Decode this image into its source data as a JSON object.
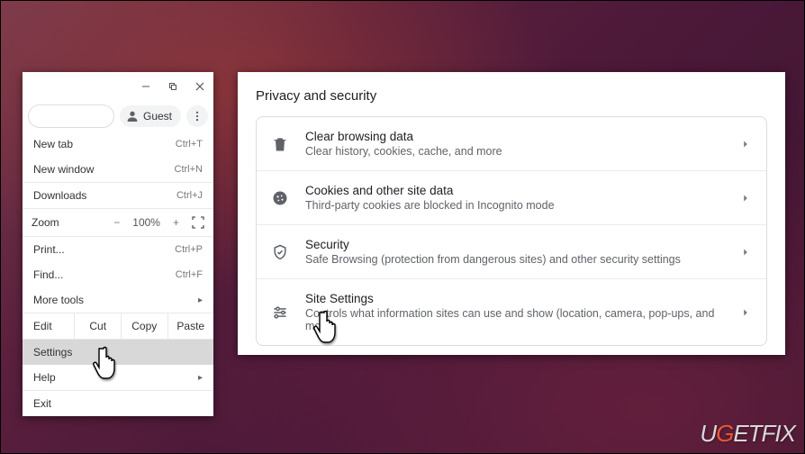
{
  "chrome_window": {
    "guest_label": "Guest",
    "menu": {
      "new_tab": "New tab",
      "new_tab_sc": "Ctrl+T",
      "new_window": "New window",
      "new_window_sc": "Ctrl+N",
      "downloads": "Downloads",
      "downloads_sc": "Ctrl+J",
      "zoom_label": "Zoom",
      "zoom_value": "100%",
      "print": "Print...",
      "print_sc": "Ctrl+P",
      "find": "Find...",
      "find_sc": "Ctrl+F",
      "more_tools": "More tools",
      "edit_label": "Edit",
      "cut": "Cut",
      "copy": "Copy",
      "paste": "Paste",
      "settings": "Settings",
      "help": "Help",
      "exit": "Exit"
    }
  },
  "settings_panel": {
    "title": "Privacy and security",
    "rows": [
      {
        "title": "Clear browsing data",
        "sub": "Clear history, cookies, cache, and more"
      },
      {
        "title": "Cookies and other site data",
        "sub": "Third-party cookies are blocked in Incognito mode"
      },
      {
        "title": "Security",
        "sub": "Safe Browsing (protection from dangerous sites) and other security settings"
      },
      {
        "title": "Site Settings",
        "sub": "Controls what information sites can use and show (location, camera, pop-ups, and more)"
      }
    ]
  },
  "watermark": "UGETFIX"
}
